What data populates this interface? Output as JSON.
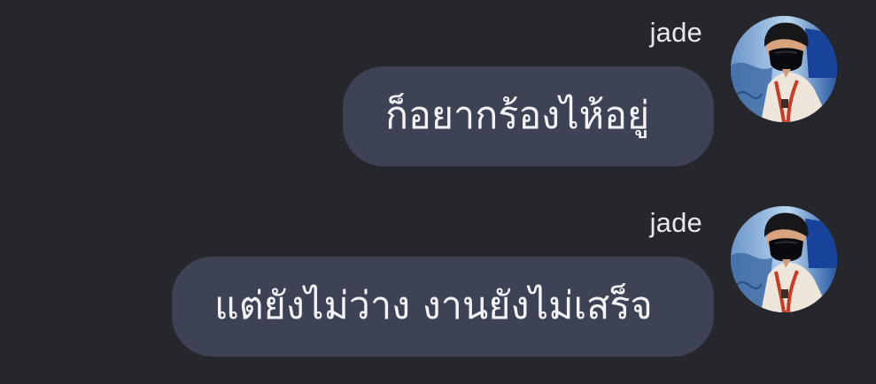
{
  "conversation": {
    "messages": [
      {
        "sender": "jade",
        "text": "ก็อยากร้องไห้อยู่",
        "avatar_icon": "user-avatar-icon"
      },
      {
        "sender": "jade",
        "text": "แต่ยังไม่ว่าง งานยังไม่เสร็จ",
        "avatar_icon": "user-avatar-icon"
      }
    ]
  },
  "colors": {
    "background": "#26272c",
    "bubble": "#3d4354",
    "text": "#f2f3f6",
    "sender": "#e8e8ea"
  }
}
